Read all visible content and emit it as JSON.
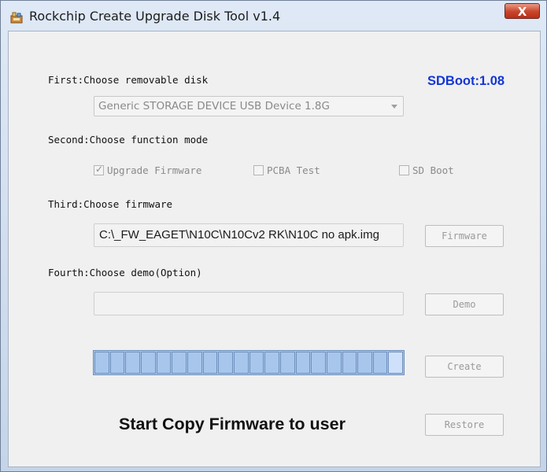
{
  "window": {
    "title": "Rockchip Create Upgrade Disk Tool v1.4",
    "close_label": "X"
  },
  "sdboot_version": "SDBoot:1.08",
  "steps": {
    "first": "First:Choose removable disk",
    "second": "Second:Choose function mode",
    "third": "Third:Choose firmware",
    "fourth": "Fourth:Choose demo(Option)"
  },
  "disk_select": {
    "value": "Generic STORAGE DEVICE USB Device   1.8G"
  },
  "modes": [
    {
      "label": "Upgrade Firmware",
      "checked": true
    },
    {
      "label": "PCBA Test",
      "checked": false
    },
    {
      "label": "SD Boot",
      "checked": false
    }
  ],
  "firmware_path": "C:\\_FW_EAGET\\N10C\\N10Cv2 RK\\N10C no apk.img",
  "demo_path": "",
  "buttons": {
    "firmware": "Firmware",
    "demo": "Demo",
    "create": "Create",
    "restore": "Restore"
  },
  "progress": {
    "segments_total": 20,
    "fraction": 1.0
  },
  "status_text": "Start Copy Firmware to user"
}
